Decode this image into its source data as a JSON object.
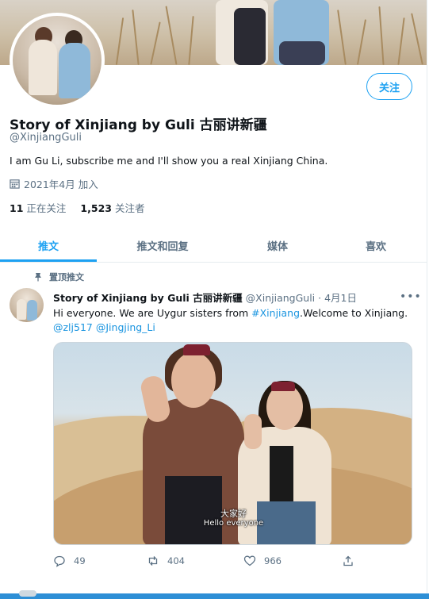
{
  "profile": {
    "name": "Story of Xinjiang by Guli 古丽讲新疆",
    "handle": "@XinjiangGuli",
    "bio": "I am Gu Li, subscribe me and I'll show you a real Xinjiang China.",
    "joined": "2021年4月 加入",
    "following_count": "11",
    "following_label": "正在关注",
    "followers_count": "1,523",
    "followers_label": "关注者",
    "follow_button": "关注"
  },
  "tabs": [
    {
      "label": "推文",
      "active": true
    },
    {
      "label": "推文和回复",
      "active": false
    },
    {
      "label": "媒体",
      "active": false
    },
    {
      "label": "喜欢",
      "active": false
    }
  ],
  "tweet": {
    "pinned_label": "置顶推文",
    "author_name": "Story of Xinjiang by Guli 古丽讲新疆",
    "author_handle_date": "@XinjiangGuli · 4月1日",
    "text_prefix": "Hi everyone. We are Uygur sisters from ",
    "hashtag": "#Xinjiang",
    "text_suffix": ".Welcome to Xinjiang.",
    "mention1": "@zlj517",
    "mention2": "@Jingjing_Li",
    "media_subtitle_cn": "大家好",
    "media_subtitle_en": "Hello everyone",
    "reply_count": "49",
    "retweet_count": "404",
    "like_count": "966"
  },
  "icons": {
    "calendar": "calendar-icon",
    "pin": "pin-icon",
    "more": "more-icon",
    "reply": "reply-icon",
    "retweet": "retweet-icon",
    "like": "heart-icon",
    "share": "share-icon"
  },
  "colors": {
    "accent": "#1da1f2",
    "link": "#1b95e0",
    "muted": "#5b7083",
    "taskbar": "#2d8fd6"
  }
}
